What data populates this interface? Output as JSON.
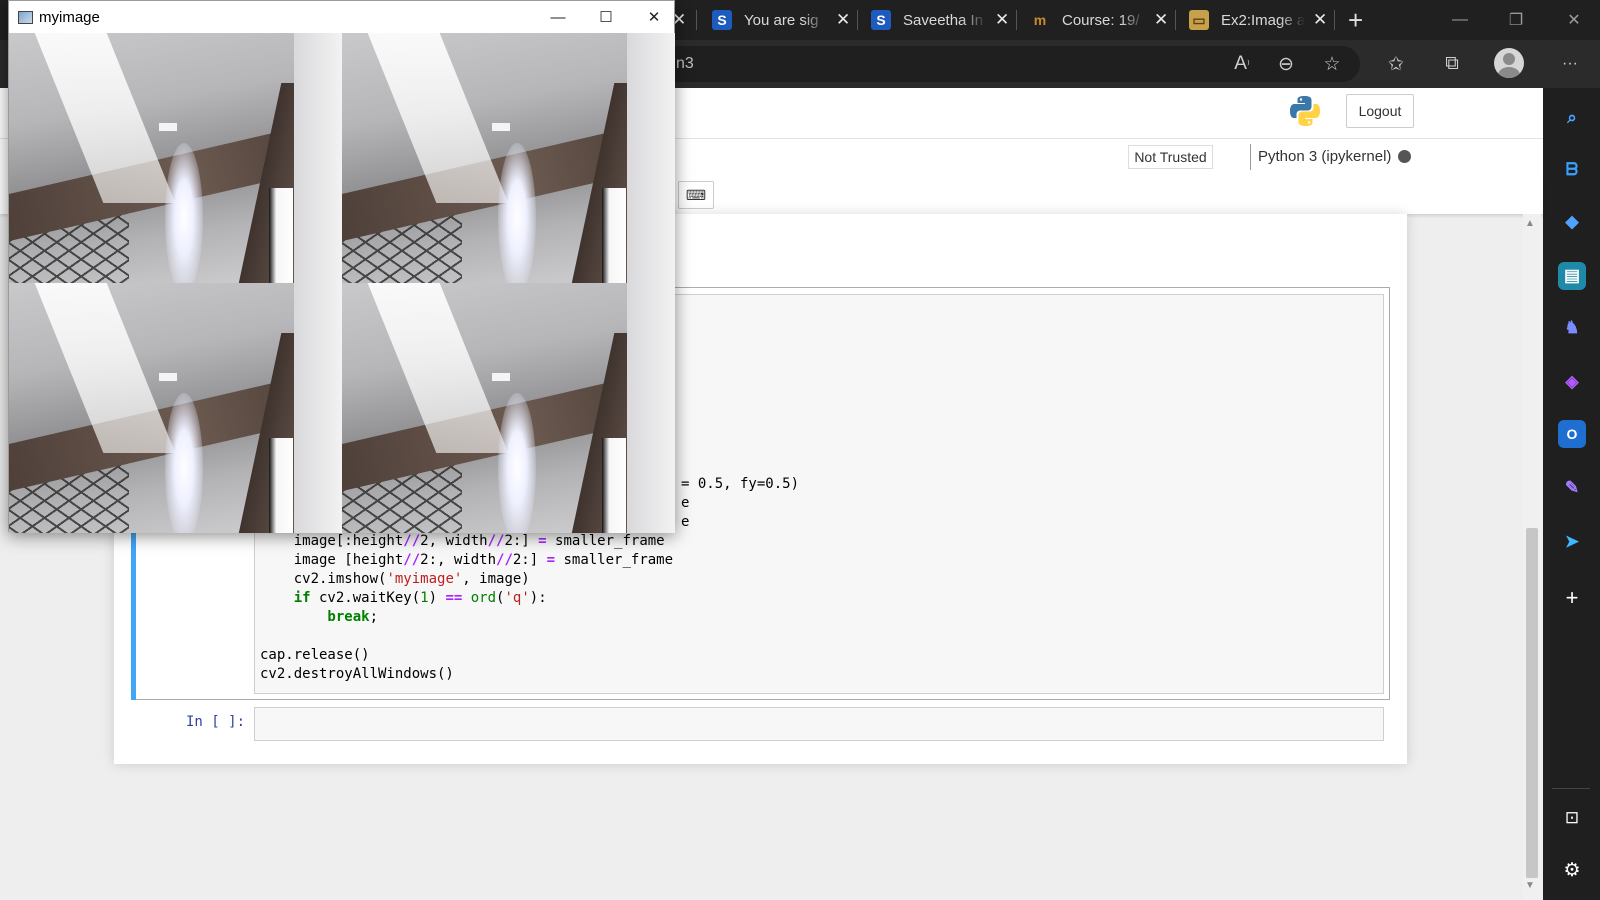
{
  "browser": {
    "tabs": [
      {
        "label": "You are sig",
        "favicon": "S",
        "favicon_color": "#1e5bbf"
      },
      {
        "label": "Saveetha In",
        "favicon": "S",
        "favicon_color": "#1e5bbf"
      },
      {
        "label": "Course: 19/",
        "favicon": "m",
        "favicon_color": "#b87a1f"
      },
      {
        "label": "Ex2:Image a",
        "favicon": "▭",
        "favicon_color": "#c7a14a"
      }
    ],
    "new_tab": "+",
    "address_fragment": "n3",
    "toolbar_icons": [
      "read-aloud-icon",
      "zoom-out-icon",
      "add-favorite-icon",
      "favorites-icon",
      "collections-icon",
      "profile-icon",
      "more-icon"
    ],
    "more_label": "···"
  },
  "sidebar_icons": [
    "search-icon",
    "bing-icon",
    "shopping-icon",
    "tools-icon",
    "games-icon",
    "office-icon",
    "outlook-icon",
    "designer-icon",
    "send-icon",
    "add-icon",
    "split-screen-icon",
    "settings-icon"
  ],
  "jupyter": {
    "logout": "Logout",
    "trust_status": "Not Trusted",
    "kernel": "Python 3 (ipykernel)",
    "keyboard_icon": "⌨",
    "empty_prompt": "In [ ]:"
  },
  "code": {
    "line_resize_tail": "= 0.5, fy=0.5)",
    "frag_e1": "e",
    "frag_e2": "e",
    "line1_a": "    image[:height",
    "line1_op": "//",
    "line1_b": "2, width",
    "line1_op2": "//",
    "line1_c": "2:] ",
    "line1_eq": "=",
    "line1_d": " smaller_frame",
    "line2_a": "    image [height",
    "line2_op": "//",
    "line2_b": "2:, width",
    "line2_op2": "//",
    "line2_c": "2:] ",
    "line2_eq": "=",
    "line2_d": " smaller_frame",
    "line3_a": "    cv2.imshow(",
    "line3_str": "'myimage'",
    "line3_b": ", image)",
    "line4_kw": "    if",
    "line4_a": " cv2.waitKey(",
    "line4_num": "1",
    "line4_b": ") ",
    "line4_eq": "==",
    "line4_c": " ",
    "line4_kw2": "ord",
    "line4_d": "(",
    "line4_str": "'q'",
    "line4_e": "):",
    "line5_kw": "        break",
    "line5_a": ";",
    "line6": "cap.release()",
    "line7": "cv2.destroyAllWindows()"
  },
  "cv_window": {
    "title": "myimage",
    "minimize": "—",
    "maximize": "☐",
    "close": "✕"
  }
}
